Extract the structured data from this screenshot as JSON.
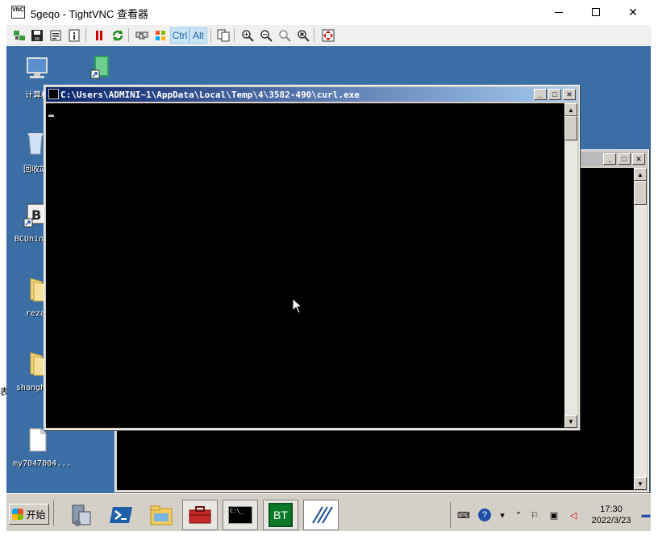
{
  "window": {
    "title": "5geqo - TightVNC 查看器",
    "app_icon_text": "VNC"
  },
  "toolbar": {
    "ctrl_label": "Ctrl",
    "alt_label": "Alt"
  },
  "desktop": {
    "background_color": "#3a6ea5",
    "icons": [
      {
        "label": "计算机",
        "icon": "computer-icon"
      },
      {
        "label": "",
        "icon": "green-book-shortcut-icon"
      },
      {
        "label": "回收站",
        "icon": "recycle-bin-icon"
      },
      {
        "label": "BCUninst",
        "icon": "uninstall-shortcut-icon"
      },
      {
        "label": "reza",
        "icon": "folder-icon"
      },
      {
        "label": "shanghai",
        "icon": "folder-icon"
      },
      {
        "label": "my7047004...",
        "icon": "document-icon"
      }
    ]
  },
  "console_front": {
    "title": "C:\\Users\\ADMINI~1\\AppData\\Local\\Temp\\4\\3582-490\\curl.exe"
  },
  "console_back": {
    "title": ""
  },
  "taskbar": {
    "start_label": "开始",
    "bt_label": "BT",
    "cmd_label": "C:\\_",
    "clock_time": "17:30",
    "clock_date": "2022/3/23"
  },
  "left_strip_glyph": "表"
}
